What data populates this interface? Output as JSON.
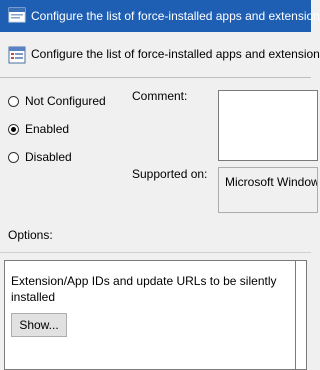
{
  "window": {
    "title": "Configure the list of force-installed apps and extensions",
    "accent": "#1e5fb4"
  },
  "header": {
    "title": "Configure the list of force-installed apps and extensions"
  },
  "state": {
    "options": [
      {
        "label": "Not Configured",
        "checked": false
      },
      {
        "label": "Enabled",
        "checked": true
      },
      {
        "label": "Disabled",
        "checked": false
      }
    ]
  },
  "comment": {
    "label": "Comment:",
    "value": ""
  },
  "supported_on": {
    "label": "Supported on:",
    "value": "Microsoft Windows"
  },
  "options_section": {
    "label": "Options:",
    "description": "Extension/App IDs and update URLs to be silently installed",
    "show_button": "Show..."
  }
}
